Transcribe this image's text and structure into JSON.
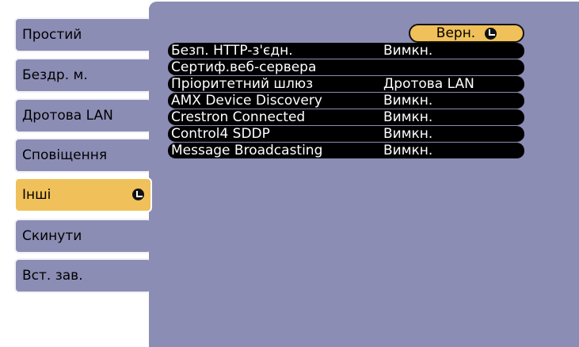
{
  "sidebar": {
    "items": [
      {
        "label": "Простий",
        "active": false
      },
      {
        "label": "Бездр. м.",
        "active": false
      },
      {
        "label": "Дротова LAN",
        "active": false
      },
      {
        "label": "Сповіщення",
        "active": false
      },
      {
        "label": "Інші",
        "active": true
      },
      {
        "label": "Скинути",
        "active": false
      },
      {
        "label": "Вст. зав.",
        "active": false
      }
    ]
  },
  "panel": {
    "back_label": "Верн.",
    "rows": [
      {
        "label": "Безп. HTTP-з'єдн.",
        "value": "Вимкн."
      },
      {
        "label": "Сертиф.веб-сервера",
        "value": ""
      },
      {
        "label": "Пріоритетний шлюз",
        "value": "Дротова LAN"
      },
      {
        "label": "AMX Device Discovery",
        "value": "Вимкн."
      },
      {
        "label": "Crestron Connected",
        "value": "Вимкн."
      },
      {
        "label": "Control4 SDDP",
        "value": "Вимкн."
      },
      {
        "label": "Message Broadcasting",
        "value": "Вимкн."
      }
    ]
  },
  "colors": {
    "menu_bg": "#8c8db5",
    "active_tab": "#f0c05a",
    "row_bg": "#000000"
  }
}
